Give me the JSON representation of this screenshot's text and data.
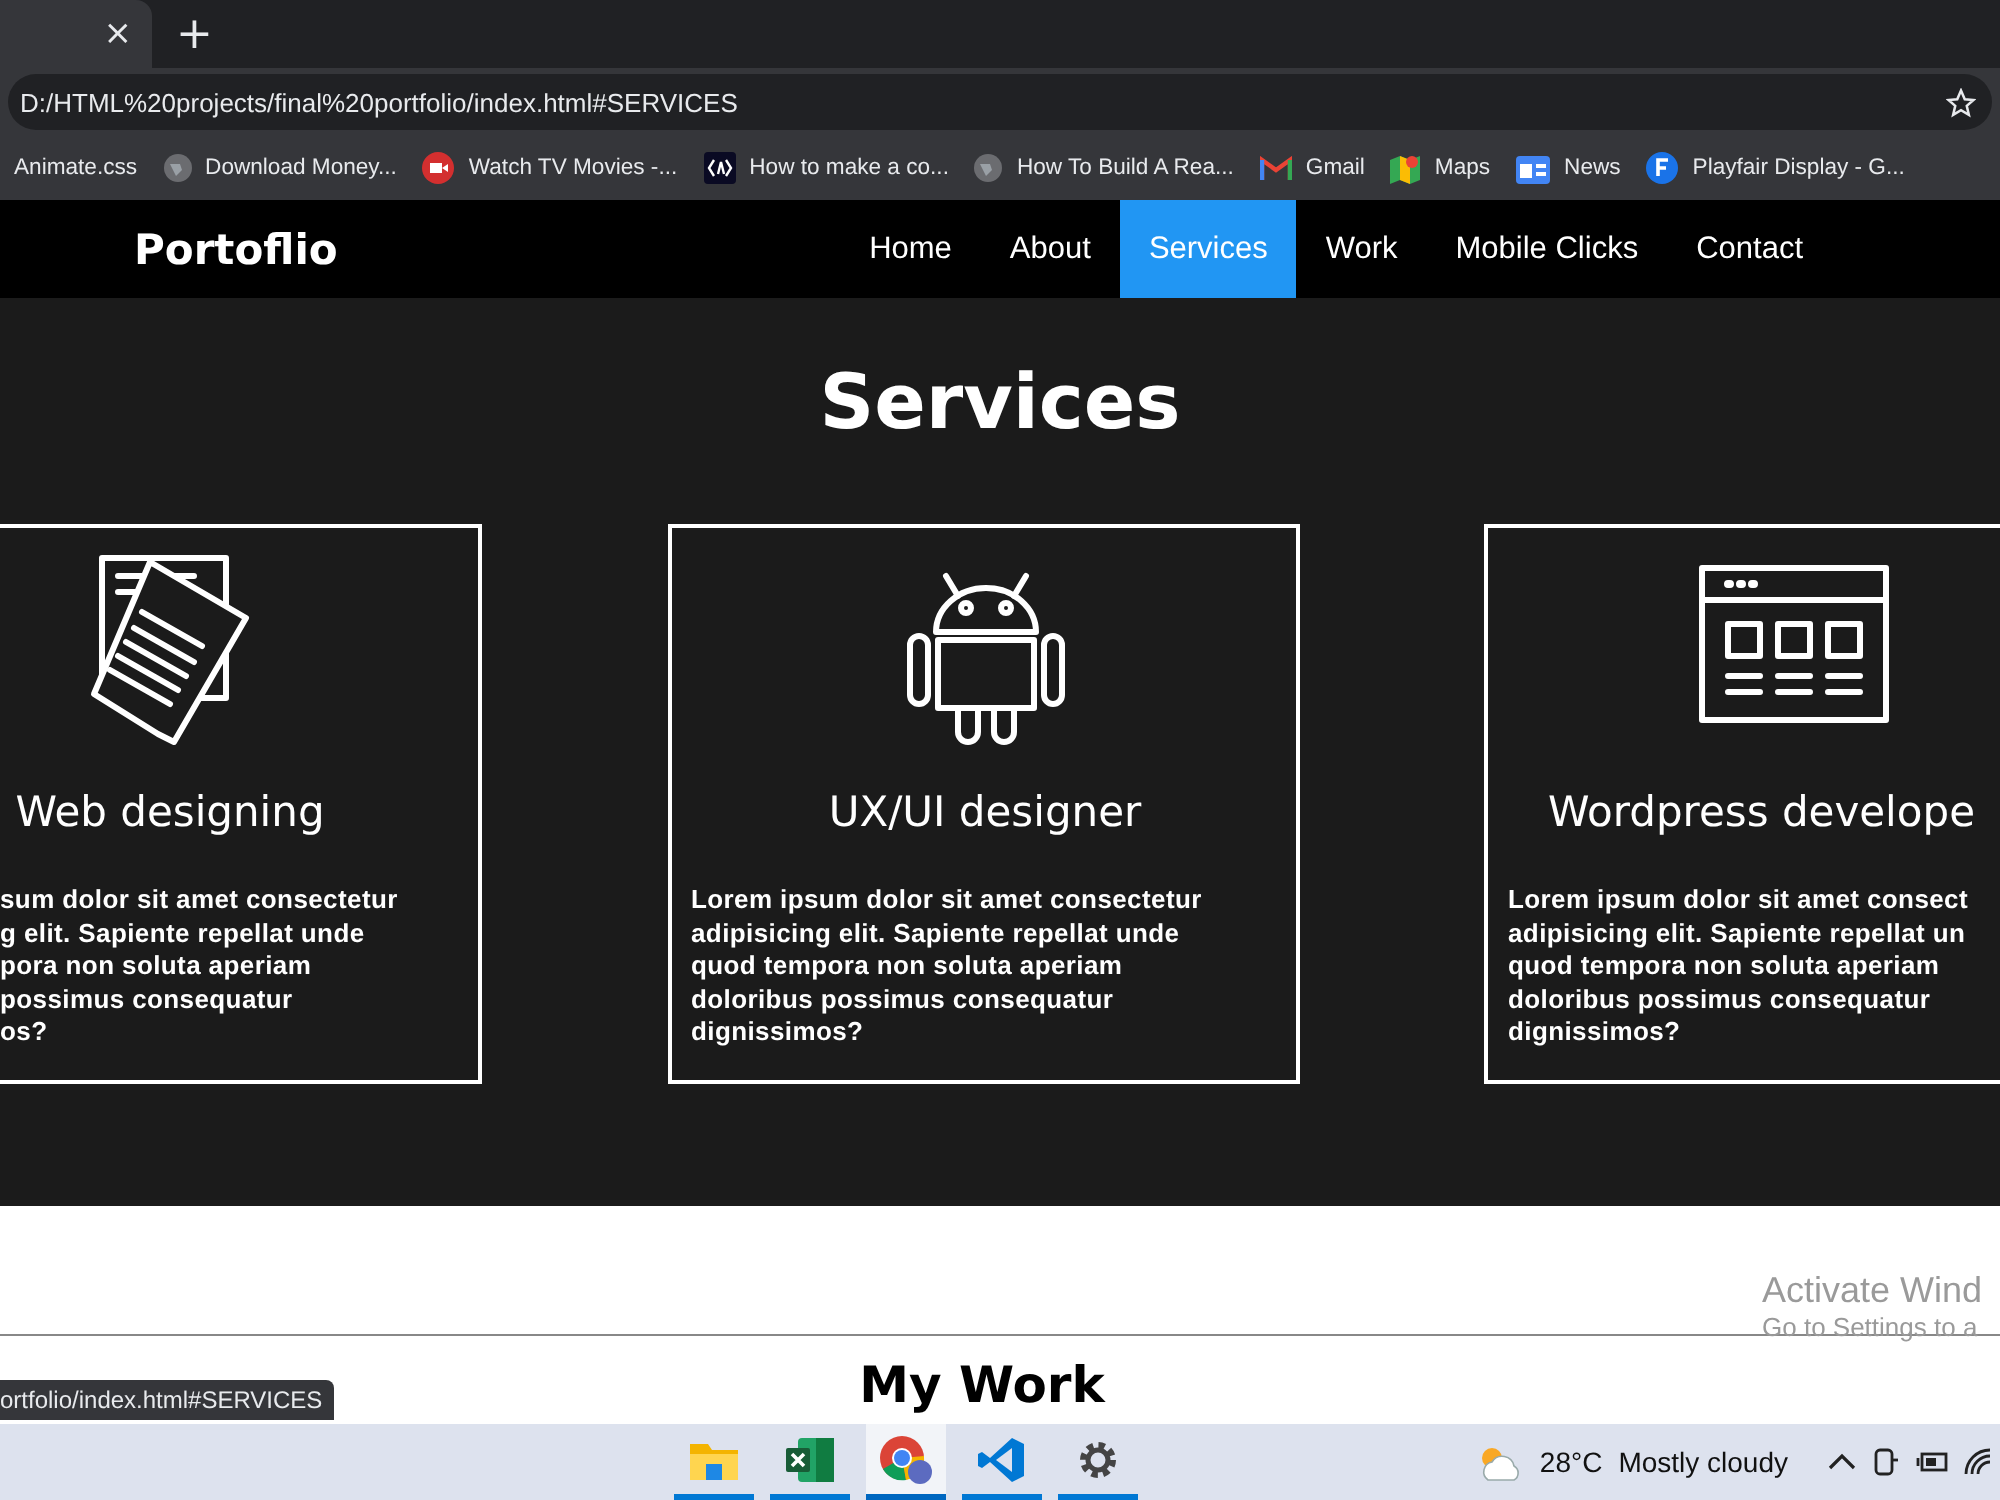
{
  "browser": {
    "tab_close": "×",
    "new_tab": "+",
    "address": "D:/HTML%20projects/final%20portfolio/index.html#SERVICES",
    "bookmarks": [
      {
        "label": "Animate.css",
        "kind": "none"
      },
      {
        "label": "Download Money...",
        "kind": "globe"
      },
      {
        "label": "Watch TV Movies -...",
        "kind": "video"
      },
      {
        "label": "How to make a co...",
        "kind": "code"
      },
      {
        "label": "How To Build A Rea...",
        "kind": "globe"
      },
      {
        "label": "Gmail",
        "kind": "mail"
      },
      {
        "label": "Maps",
        "kind": "map"
      },
      {
        "label": "News",
        "kind": "news"
      },
      {
        "label": "Playfair Display - G...",
        "kind": "font"
      }
    ]
  },
  "navbar": {
    "logo": "Portoflio",
    "items": [
      {
        "label": "Home",
        "selected": false
      },
      {
        "label": "About",
        "selected": false
      },
      {
        "label": "Services",
        "selected": true
      },
      {
        "label": "Work",
        "selected": false
      },
      {
        "label": "Mobile Clicks",
        "selected": false
      },
      {
        "label": "Contact",
        "selected": false
      }
    ]
  },
  "services": {
    "heading": "Services",
    "cards": [
      {
        "kind": "document",
        "title": "Web designing",
        "description": "sum dolor sit amet consectetur\ng elit. Sapiente repellat unde\npora non soluta aperiam\npossimus consequatur\nos?"
      },
      {
        "kind": "android",
        "title": "UX/UI designer",
        "description": "Lorem ipsum dolor sit amet consectetur\nadipisicing elit. Sapiente repellat unde\nquod tempora non soluta aperiam\ndoloribus possimus consequatur\ndignissimos?"
      },
      {
        "kind": "browser",
        "title": "Wordpress develope",
        "description": "Lorem ipsum dolor sit amet consect\nadipisicing elit. Sapiente repellat un\nquod tempora non soluta aperiam\ndoloribus possimus consequatur\ndignissimos?"
      }
    ]
  },
  "work": {
    "heading": "My Work"
  },
  "activation": {
    "title": "Activate Wind",
    "subtitle": "Go to Settings to a"
  },
  "status_url": "ortfolio/index.html#SERVICES",
  "taskbar": {
    "apps": [
      {
        "kind": "folder",
        "selected": false
      },
      {
        "kind": "excel",
        "selected": false
      },
      {
        "kind": "chrome",
        "selected": true
      },
      {
        "kind": "vscode",
        "selected": false
      },
      {
        "kind": "settings",
        "selected": false
      }
    ],
    "temperature": "28°C",
    "weather": "Mostly cloudy"
  }
}
